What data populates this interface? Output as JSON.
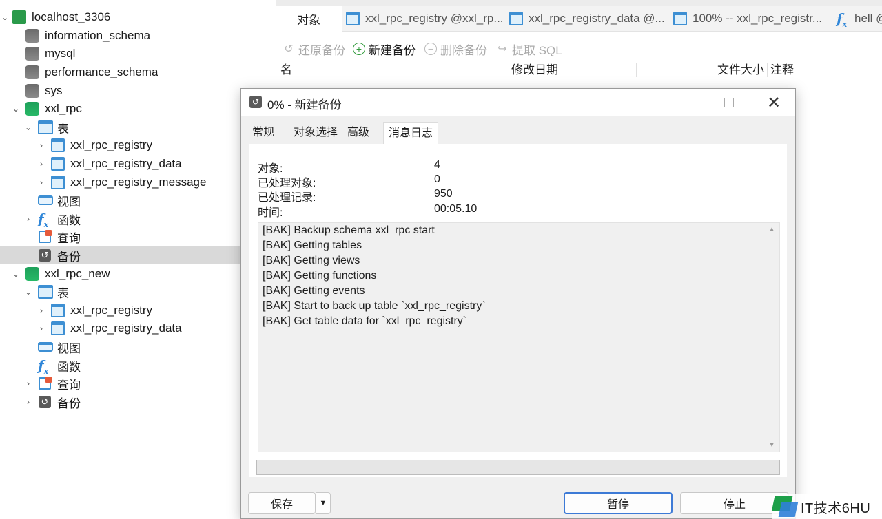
{
  "tree": {
    "server": "localhost_3306",
    "databases": [
      {
        "name": "information_schema"
      },
      {
        "name": "mysql"
      },
      {
        "name": "performance_schema"
      },
      {
        "name": "sys"
      }
    ],
    "xxl_rpc": {
      "name": "xxl_rpc",
      "tables_label": "表",
      "tables": [
        "xxl_rpc_registry",
        "xxl_rpc_registry_data",
        "xxl_rpc_registry_message"
      ],
      "views_label": "视图",
      "functions_label": "函数",
      "queries_label": "查询",
      "backups_label": "备份"
    },
    "xxl_rpc_new": {
      "name": "xxl_rpc_new",
      "tables_label": "表",
      "tables": [
        "xxl_rpc_registry",
        "xxl_rpc_registry_data"
      ],
      "views_label": "视图",
      "functions_label": "函数",
      "queries_label": "查询",
      "backups_label": "备份"
    }
  },
  "tabs": [
    {
      "label": "对象"
    },
    {
      "label": "xxl_rpc_registry @xxl_rp..."
    },
    {
      "label": "xxl_rpc_registry_data @..."
    },
    {
      "label": "100% -- xxl_rpc_registr..."
    },
    {
      "label": "hell @"
    }
  ],
  "toolbar": {
    "restore": "还原备份",
    "new_backup": "新建备份",
    "delete_backup": "删除备份",
    "extract_sql": "提取 SQL"
  },
  "columns": [
    "名",
    "修改日期",
    "文件大小",
    "注释"
  ],
  "dialog": {
    "title": "0% - 新建备份",
    "tabs": [
      "常规",
      "对象选择",
      "高级",
      "消息日志"
    ],
    "stats": [
      {
        "label": "对象:",
        "value": "4"
      },
      {
        "label": "已处理对象:",
        "value": "0"
      },
      {
        "label": "已处理记录:",
        "value": "950"
      },
      {
        "label": "时间:",
        "value": "00:05.10"
      }
    ],
    "log": [
      "[BAK] Backup schema xxl_rpc start",
      "[BAK] Getting tables",
      "[BAK] Getting views",
      "[BAK] Getting functions",
      "[BAK] Getting events",
      "[BAK] Start to back up table `xxl_rpc_registry`",
      "[BAK] Get table data for `xxl_rpc_registry`"
    ],
    "progress": 0,
    "buttons": {
      "save": "保存",
      "pause": "暂停",
      "stop": "停止"
    }
  },
  "watermark": "IT技术6HU"
}
